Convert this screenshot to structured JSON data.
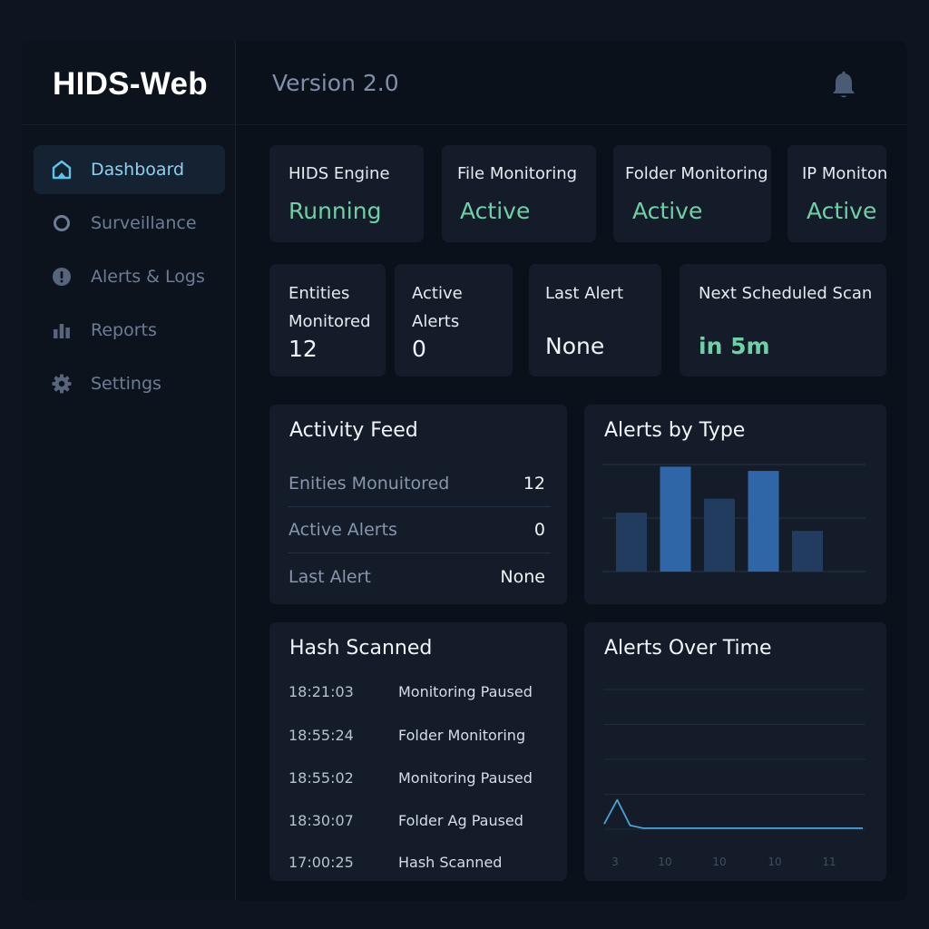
{
  "app": {
    "brand": "HIDS-Web",
    "version": "Version 2.0"
  },
  "sidebar": {
    "items": [
      {
        "label": "Dashboard",
        "icon": "home-icon",
        "active": true
      },
      {
        "label": "Surveillance",
        "icon": "circle-icon",
        "active": false
      },
      {
        "label": "Alerts & Logs",
        "icon": "info-icon",
        "active": false
      },
      {
        "label": "Reports",
        "icon": "bar-chart-icon",
        "active": false
      },
      {
        "label": "Settings",
        "icon": "gear-icon",
        "active": false
      }
    ]
  },
  "header": {
    "notification_icon": "bell-icon"
  },
  "status_cards": [
    {
      "label": "HIDS Engine",
      "value": "Running"
    },
    {
      "label": "File Monitoring",
      "value": "Active"
    },
    {
      "label": "Folder Monitoring",
      "value": "Active"
    },
    {
      "label": "IP Moniton",
      "value": "Active"
    }
  ],
  "metric_cards": [
    {
      "label": "Entities\nMonitored",
      "value": "12"
    },
    {
      "label": "Active\nAlerts",
      "value": "0"
    },
    {
      "label": "Last Alert",
      "value": "None"
    },
    {
      "label": "Next Scheduled Scan",
      "value": "in 5m"
    }
  ],
  "activity_feed": {
    "title": "Activity Feed",
    "rows": [
      {
        "key": "Enities Monuitored",
        "value": "12"
      },
      {
        "key": "Active Alerts",
        "value": "0"
      },
      {
        "key": "Last Alert",
        "value": "None"
      }
    ]
  },
  "hash_scanned": {
    "title": "Hash Scanned",
    "rows": [
      {
        "time": "18:21:03",
        "event": "Monitoring Paused"
      },
      {
        "time": "18:55:24",
        "event": "Folder Monitoring"
      },
      {
        "time": "18:55:02",
        "event": "Monitoring Paused"
      },
      {
        "time": "18:30:07",
        "event": "Folder Ag Paused"
      },
      {
        "time": "17:00:25",
        "event": "Hash Scanned"
      }
    ]
  },
  "chart_data": [
    {
      "type": "bar",
      "title": "Alerts by Type",
      "values": [
        0.55,
        0.98,
        0.68,
        0.94,
        0.38
      ],
      "ylim": [
        0,
        1
      ],
      "grid": true,
      "colors": [
        "#223c60",
        "#2f66a8",
        "#223c60",
        "#2f66a8",
        "#223c60"
      ]
    },
    {
      "type": "line",
      "title": "Alerts Over Time",
      "x_tick_labels": [
        "3",
        "10",
        "10",
        "10",
        "11"
      ],
      "x": [
        0,
        0.05,
        0.1,
        0.15,
        0.2,
        0.3,
        0.5,
        0.7,
        1.0
      ],
      "values": [
        0.05,
        0.22,
        0.04,
        0.02,
        0.02,
        0.02,
        0.02,
        0.02,
        0.02
      ],
      "ylim": [
        0,
        1
      ],
      "grid": true,
      "color": "#4aa3d6"
    }
  ]
}
